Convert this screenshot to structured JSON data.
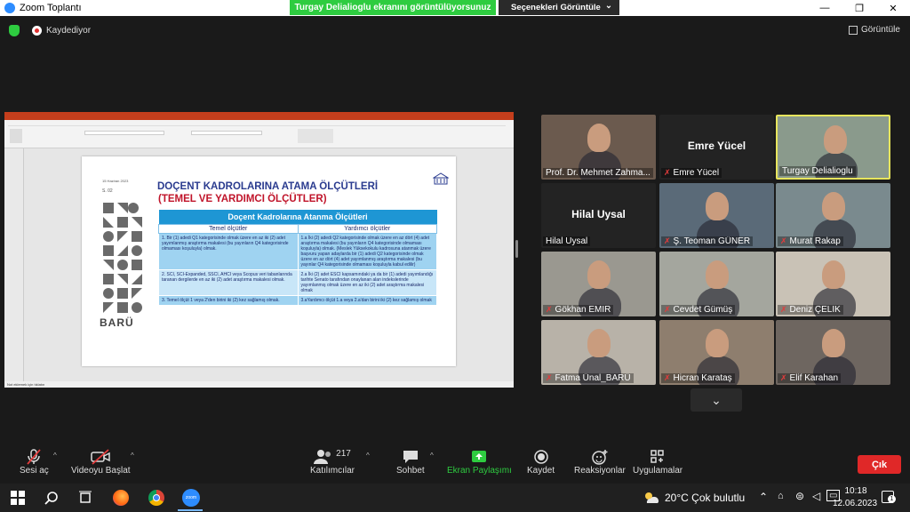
{
  "titlebar": {
    "app_title": "Zoom Toplantı",
    "minimize": "—",
    "restore": "❐",
    "close": "✕"
  },
  "share_banner": {
    "text": "Turgay Delialioglu ekranını görüntülüyorsunuz",
    "view_options": "Seçenekleri Görüntüle",
    "caret": "⌄"
  },
  "status": {
    "recording": "Kaydediyor",
    "view_label": "Görüntüle"
  },
  "slide": {
    "date": "15 Haziran 2023",
    "number": "S. 02",
    "title_line1": "DOÇENT KADROLARINA ATAMA ÖLÇÜTLERİ",
    "title_line2": "(TEMEL VE YARDIMCI ÖLÇÜTLER)",
    "table_title": "Doçent Kadrolarına Atanma Ölçütleri",
    "col_headers": [
      "Temel ölçütler",
      "Yardımcı ölçütler"
    ],
    "rows": [
      [
        "1. Bir (1) adedi Q1 kategorisinde olmak üzere en az iki (2) adet yayımlanmış araştırma makalesi (bu yayınların Q4 kategorisinde olmaması koşuluyla) olmak.",
        "1.a İki (2) adedi Q2 kategorisinde olmak üzere en az dört (4) adet araştırma makalesi (bu yayınların Q4 kategorisinde olmaması koşuluyla) olmak. (Meslek Yüksekokulu kadrosuna atanmak üzere başvuru yapan adaylarda bir (1) adedi Q2 kategorisinde olmak üzere en az dört (4) adet yayımlanmış araştırma makalesi (bu yayınlar Q4 kategorisinde olmaması koşuluyla kabul edilir)"
      ],
      [
        "2. SCI, SCI-Expanded, SSCI, AHCI veya Scopus veri tabanlarında taranan dergilerde en az iki (2) adet araştırma makalesi olmak.",
        "2.a İki (2) adet ESCI kapsamındaki ya da bir (1) adedi yayımlandığı tarihte Senato tarafından onaylanan alan indekslerinde yayımlanmış olmak üzere en az iki (2) adet araştırma makalesi olmak"
      ],
      [
        "3. Temel ölçüt 1 veya 2'den birini iki (2) kez sağlamış olmak.",
        "3.aYardımcı ölçüt 1.a veya 2.a'dan birini iki (2) kez sağlamış olmak"
      ]
    ],
    "logo_text": "BARÜ",
    "status_text": "Not eklemek için tıklatın"
  },
  "participants": [
    {
      "name": "Prof. Dr. Mehmet Zahma...",
      "muted": false,
      "video": true,
      "bg": "#6b5a4e"
    },
    {
      "name": "Emre Yücel",
      "muted": true,
      "video": false,
      "big": "Emre Yücel"
    },
    {
      "name": "Turgay Delialioglu",
      "muted": false,
      "video": true,
      "active": true,
      "bg": "#8a9a8c"
    },
    {
      "name": "Hilal Uysal",
      "muted": false,
      "video": false,
      "big": "Hilal Uysal"
    },
    {
      "name": "Ş. Teoman GÜNER",
      "muted": true,
      "video": true,
      "bg": "#5a6a78"
    },
    {
      "name": "Murat Rakap",
      "muted": true,
      "video": true,
      "bg": "#7a8a8e"
    },
    {
      "name": "Gökhan EMİR",
      "muted": true,
      "video": true,
      "bg": "#9a9890"
    },
    {
      "name": "Cevdet Gümüş",
      "muted": true,
      "video": true,
      "bg": "#a4a69e"
    },
    {
      "name": "Deniz ÇELİK",
      "muted": true,
      "video": true,
      "bg": "#c9c2b6"
    },
    {
      "name": "Fatma Ünal_BARÜ",
      "muted": true,
      "video": true,
      "bg": "#b8b2a8"
    },
    {
      "name": "Hicran Karataş",
      "muted": true,
      "video": true,
      "bg": "#8e7e6e"
    },
    {
      "name": "Elif Karahan",
      "muted": true,
      "video": true,
      "bg": "#6e6660"
    }
  ],
  "gallery": {
    "down_arrow": "⌄"
  },
  "toolbar": {
    "mute_label": "Sesi aç",
    "video_label": "Videoyu Başlat",
    "participants_label": "Katılımcılar",
    "participants_count": "217",
    "chat_label": "Sohbet",
    "share_label": "Ekran Paylaşımı",
    "record_label": "Kaydet",
    "reactions_label": "Reaksiyonlar",
    "apps_label": "Uygulamalar",
    "leave_label": "Çık",
    "caret": "^"
  },
  "taskbar": {
    "weather": "20°C  Çok bulutlu",
    "time": "10:18",
    "date": "12.06.2023",
    "zoom_icon_text": "zoom",
    "notif_count": "1"
  },
  "colors": {
    "share_green": "#2ecc40",
    "leave_red": "#e02828",
    "active_border": "#e7e55d",
    "slide_blue": "#1e96d4"
  }
}
